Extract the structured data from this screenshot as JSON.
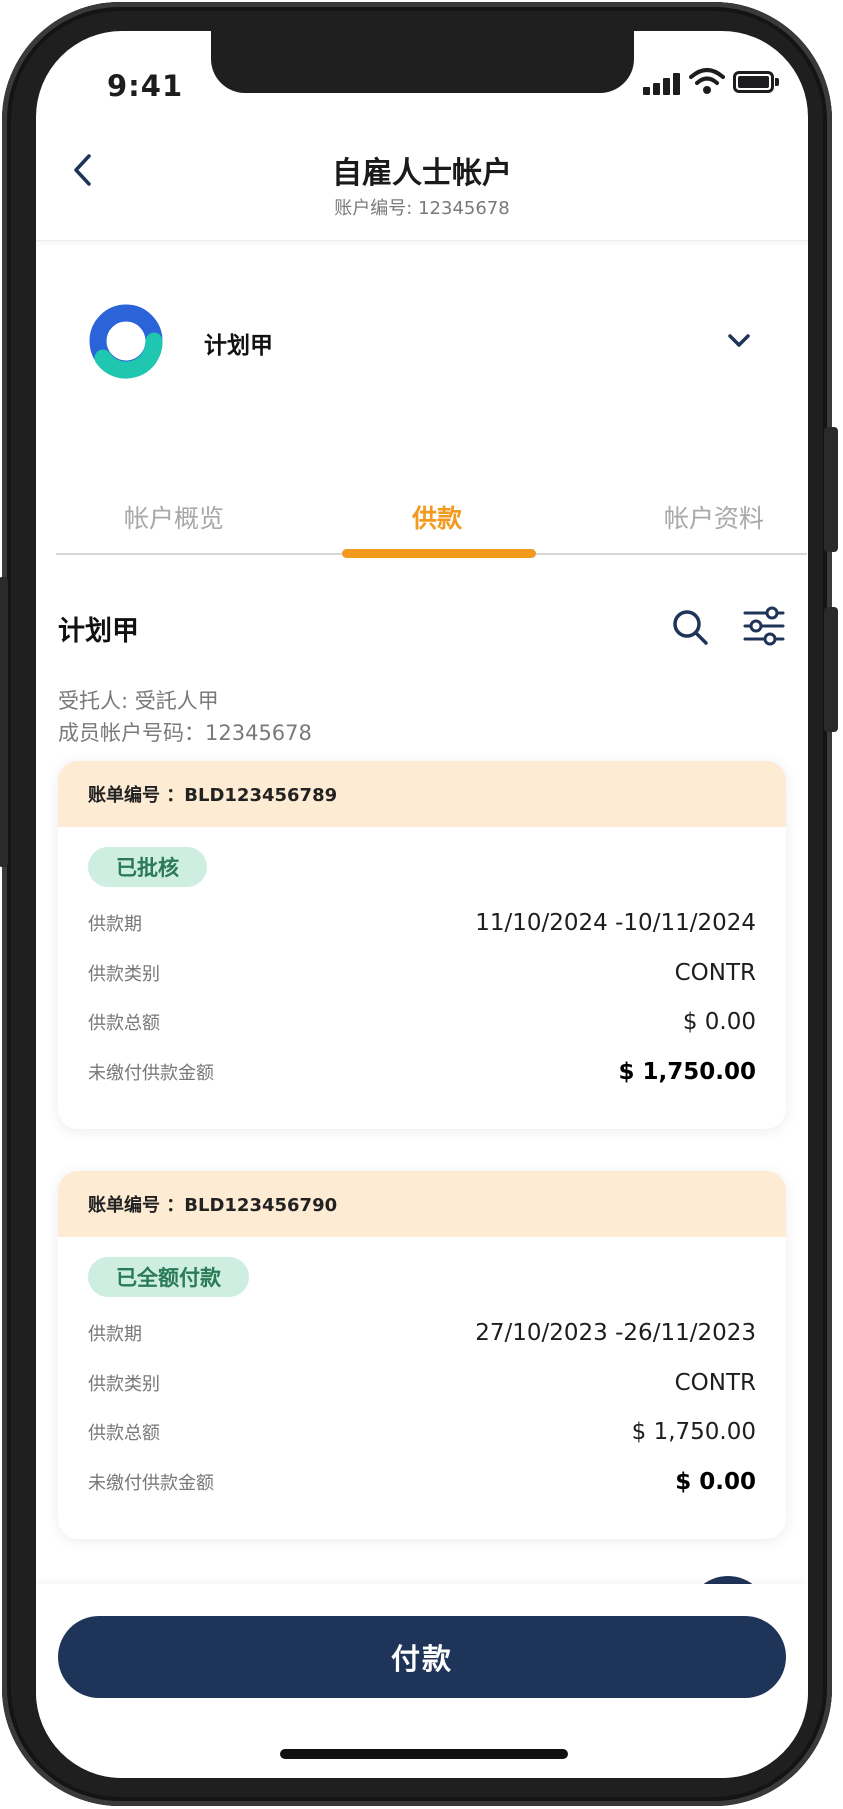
{
  "status_bar": {
    "time": "9:41"
  },
  "header": {
    "title": "自雇人士帐户",
    "subtitle": "账户编号: 12345678"
  },
  "plan_selector": {
    "name": "计划甲"
  },
  "tabs": [
    {
      "label": "帐户概览",
      "active": false
    },
    {
      "label": "供款",
      "active": true
    },
    {
      "label": "帐户资料",
      "active": false
    }
  ],
  "section": {
    "title": "计划甲",
    "trustee": "受托人: 受託人甲",
    "member_account": "成员帐户号码：12345678"
  },
  "bills": [
    {
      "bill_no": "账单编号 ：BLD123456789",
      "status": "已批核",
      "rows": [
        {
          "label": "供款期",
          "value": "11/10/2024 -10/11/2024"
        },
        {
          "label": "供款类别",
          "value": "CONTR"
        },
        {
          "label": "供款总额",
          "value": "$ 0.00"
        },
        {
          "label": "未缴付供款金额",
          "value": "$ 1,750.00"
        }
      ]
    },
    {
      "bill_no": "账单编号 ：BLD123456790",
      "status": "已全额付款",
      "rows": [
        {
          "label": "供款期",
          "value": "27/10/2023 -26/11/2023"
        },
        {
          "label": "供款类别",
          "value": "CONTR"
        },
        {
          "label": "供款总额",
          "value": "$ 1,750.00"
        },
        {
          "label": "未缴付供款金额",
          "value": "$ 0.00"
        }
      ]
    }
  ],
  "actions": {
    "pay_label": "付款"
  },
  "colors": {
    "accent": "#f39a1e",
    "primary_navy": "#1f3459",
    "card_header_bg": "#fdebd4",
    "badge_bg": "#cdeee0",
    "badge_text": "#2b7a57",
    "logo_blue": "#2b63d9",
    "logo_teal": "#1fc6b0"
  },
  "icons": {
    "back": "back-arrow-icon",
    "dropdown": "chevron-down-icon",
    "search": "search-icon",
    "filter": "filter-sliders-icon"
  }
}
